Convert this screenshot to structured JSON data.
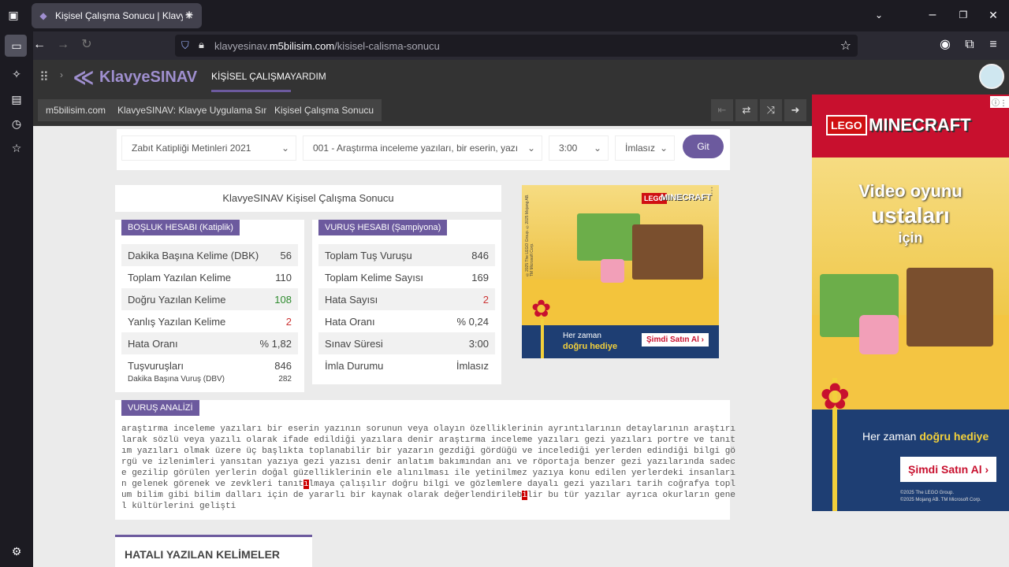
{
  "browser": {
    "tab_title": "Kişisel Çalışma Sonucu | KlavyeSİ",
    "url_prefix": "klavyesinav.",
    "url_domain": "m5bilisim.com",
    "url_path": "/kisisel-calisma-sonucu"
  },
  "site": {
    "logo": "KlavyeSINAV",
    "nav": [
      "KİŞİSEL ÇALIŞMA",
      "YARDIM"
    ],
    "breadcrumbs": [
      "m5bilisim.com",
      "KlavyeSINAV: Klavye Uygulama Sınavı",
      "Kişisel Çalışma Sonucu"
    ]
  },
  "filters": {
    "category": "Zabıt Katipliği Metinleri 2021",
    "text": "001 - Araştırma inceleme yazıları, bir eserin, yazı",
    "duration": "3:00",
    "spelling": "İmlasız",
    "go": "Git"
  },
  "result_title": "KlavyeSINAV Kişisel Çalışma Sonucu",
  "gap": {
    "title": "BOŞLUK HESABI (Katiplik)",
    "rows": [
      {
        "label": "Dakika Başına Kelime (DBK)",
        "value": "56"
      },
      {
        "label": "Toplam Yazılan Kelime",
        "value": "110"
      },
      {
        "label": "Doğru Yazılan Kelime",
        "value": "108"
      },
      {
        "label": "Yanlış Yazılan Kelime",
        "value": "2"
      },
      {
        "label": "Hata Oranı",
        "value": "% 1,82"
      },
      {
        "label": "Tuşvuruşları",
        "value": "846"
      }
    ],
    "dbv_label": "Dakika Başına Vuruş (DBV)",
    "dbv_value": "282"
  },
  "keys": {
    "title": "VURUŞ HESABI (Şampiyona)",
    "rows": [
      {
        "label": "Toplam Tuş Vuruşu",
        "value": "846"
      },
      {
        "label": "Toplam Kelime Sayısı",
        "value": "169"
      },
      {
        "label": "Hata Sayısı",
        "value": "2"
      },
      {
        "label": "Hata Oranı",
        "value": "% 0,24"
      },
      {
        "label": "Sınav Süresi",
        "value": "3:00"
      },
      {
        "label": "İmla Durumu",
        "value": "İmlasız"
      }
    ]
  },
  "analysis": {
    "title": "VURUŞ ANALİZİ",
    "before": "araştırma inceleme yazıları bir eserin yazının sorunun veya olayın özelliklerinin ayrıntılarının detaylarının araştırılarak sözlü veya yazılı olarak ifade edildiği yazılara denir araştırma inceleme yazıları gezi yazıları portre ve tanıtım yazıları olmak üzere üç başlıkta toplanabilir bir yazarın gezdiği gördüğü ve incelediği yerlerden edindiği bilgi görgü ve izlenimleri yansıtan yazıya gezi yazısı denir anlatım bakımından anı ve röportaja benzer gezi yazılarında sadece gezilip görülen yerlerin doğal güzelliklerinin ele alınılması ile yetinilmez yazıya konu edilen yerlerdeki insanların gelenek görenek ve zevkleri tanıt",
    "err1": "ı",
    "middle": "lmaya çalışılır doğru bilgi ve gözlemlere dayalı gezi yazıları tarih coğrafya toplum bilim gibi bilim dalları için de yararlı bir kaynak olarak değerlendirileb",
    "err2": "i",
    "after": "lir bu tür yazılar ayrıca okurların genel kültürlerini gelişti"
  },
  "wrong_words_title": "HATALI YAZILAN KELİMELER",
  "ad_small": {
    "brand": "LEGO",
    "product": "MINECRAFT",
    "line1": "Her zaman",
    "line2": "doğru hediye",
    "cta": "Şimdi Satın Al ›",
    "legal1": "©2025 The LEGO Group.",
    "legal2": "©2025 Mojang AB. TM Microsoft Corp."
  },
  "ad_big": {
    "brand": "LEGO",
    "product": "MINECRAFT",
    "headline1": "Video oyunu",
    "headline2": "ustaları",
    "headline3": "için",
    "line1": "Her zaman",
    "line2": "doğru hediye",
    "cta": "Şimdi Satın Al ›",
    "legal1": "©2025 The LEGO Group.",
    "legal2": "©2025 Mojang AB. TM Microsoft Corp."
  }
}
